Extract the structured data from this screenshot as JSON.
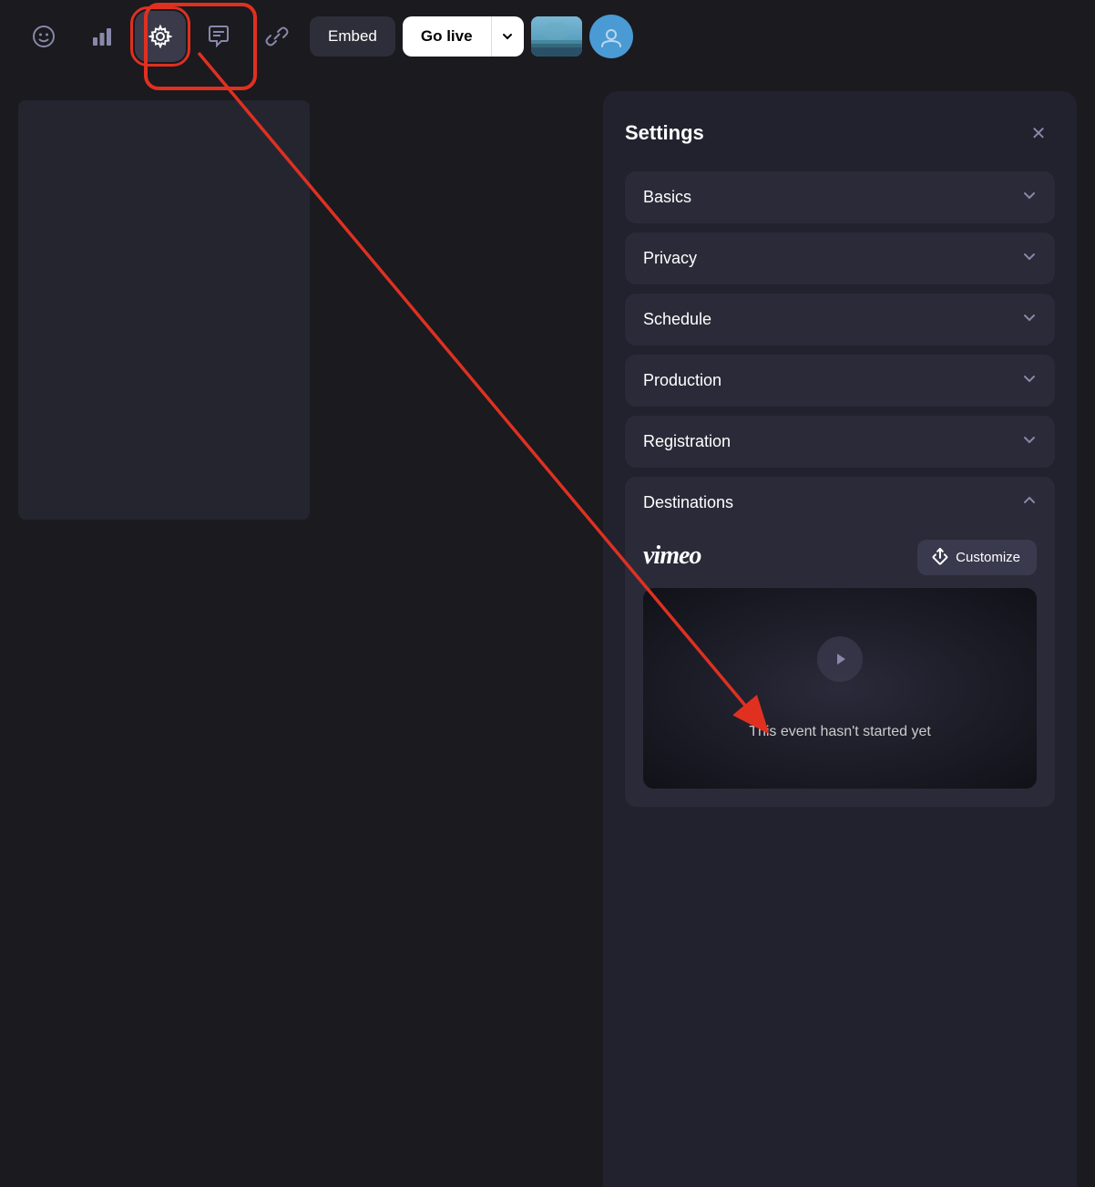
{
  "toolbar": {
    "embed_label": "Embed",
    "go_live_label": "Go live",
    "settings_title": "Settings",
    "close_label": "×"
  },
  "settings": {
    "title": "Settings",
    "sections": [
      {
        "id": "basics",
        "label": "Basics",
        "expanded": false
      },
      {
        "id": "privacy",
        "label": "Privacy",
        "expanded": false
      },
      {
        "id": "schedule",
        "label": "Schedule",
        "expanded": false
      },
      {
        "id": "production",
        "label": "Production",
        "expanded": false
      },
      {
        "id": "registration",
        "label": "Registration",
        "expanded": false
      },
      {
        "id": "destinations",
        "label": "Destinations",
        "expanded": true
      }
    ],
    "destinations": {
      "vimeo_label": "vimeo",
      "customize_label": "Customize",
      "preview_text": "This event hasn't started yet"
    }
  },
  "icons": {
    "smiley": "☺",
    "chart": "▦",
    "gear": "⚙",
    "chat": "⌨",
    "link": "⛓",
    "chevron_down": "∨",
    "chevron_up": "∧",
    "close": "×",
    "external_link": "↗",
    "play": "▶"
  }
}
